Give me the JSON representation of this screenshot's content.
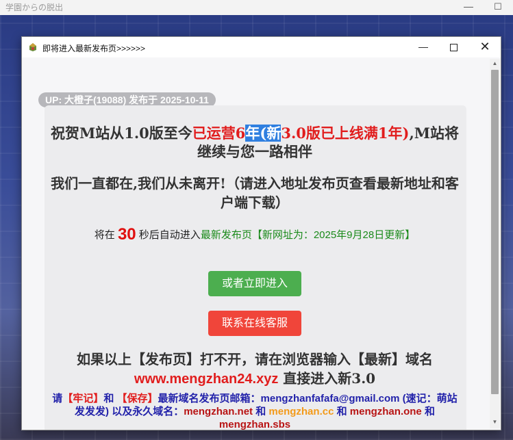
{
  "background_window": {
    "title": "学園からの脱出",
    "minimize_glyph": "—",
    "maximize_glyph": "☐"
  },
  "dialog": {
    "title": "即将进入最新发布页>>>>>>",
    "minimize_glyph": "—",
    "close_glyph": "✕"
  },
  "post": {
    "up_badge": "UP: 大橙子(19088) 发布于 2025-10-11",
    "headline": {
      "part1": "祝贺M站从1.0版至今",
      "part2": "已运营6",
      "selected": "年(新",
      "part3": "3.0版已上线满1年)",
      "part4": ",M站将继续与您一路相伴"
    },
    "sub_headline": "我们一直都在,我们从未离开!（请进入地址发布页查看最新地址和客户端下载）",
    "countdown": {
      "prefix": "将在 ",
      "seconds": "30",
      "middle": " 秒后自动进入",
      "link_text": "最新发布页【新网址为：2025年9月28日更新】"
    },
    "enter_button": "或者立即进入",
    "service_button": "联系在线客服",
    "fail_text": {
      "part1": "如果以上【发布页】打不开，请在浏览器输入【最新】域名 ",
      "url": "www.mengzhan24.xyz",
      "part2": " 直接进入新3.0"
    },
    "note": {
      "p1": "请",
      "r1": "【牢记】",
      "p2": "和 ",
      "r2": "【保存】",
      "p3": "最新域名发布页邮箱：mengzhanfafafa@gmail.com (速记：萌站发发发) 以及永久域名：",
      "d1": "mengzhan.net",
      "and1": " 和 ",
      "d2": "mengzhan.cc",
      "and2": " 和 ",
      "d3": "mengzhan.one",
      "and3": " 和 ",
      "d4": "mengzhan.sbs"
    }
  },
  "colors": {
    "accent_red": "#e11d1d",
    "link_green": "#1a8a1a",
    "button_green": "#4cae4f",
    "button_red": "#f0453a",
    "note_blue": "#2222aa",
    "domain_orange": "#f39a1a"
  }
}
